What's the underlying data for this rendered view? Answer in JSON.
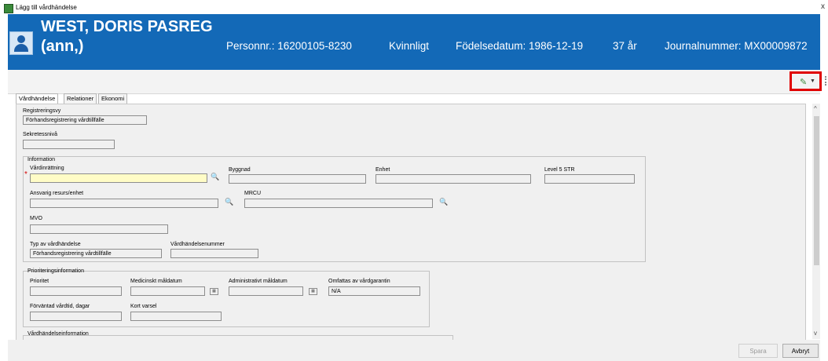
{
  "window": {
    "title": "Lägg till vårdhändelse",
    "close": "x"
  },
  "patient": {
    "name_line1": "WEST, DORIS PASREG",
    "name_line2": "(ann,)",
    "personnr": "Personnr.: 16200105-8230",
    "gender": "Kvinnligt",
    "birthdate": "Födelsedatum: 1986-12-19",
    "age": "37 år",
    "journal": "Journalnummer: MX00009872"
  },
  "toolbar": {
    "action_icon": "pen-icon",
    "dropdown_icon": "chevron-down-icon"
  },
  "tabs": [
    "Vårdhändelse",
    "Relationer",
    "Ekonomi"
  ],
  "form": {
    "registreringsvy_label": "Registreringsvy",
    "registreringsvy_value": "Förhandsregistrering vårdtillfälle",
    "sekretess_label": "Sekretessnivå",
    "sekretess_value": "",
    "information_group": "Information",
    "vardinrattning_label": "Vårdinrättning",
    "byggnad_label": "Byggnad",
    "enhet_label": "Enhet",
    "level5_label": "Level 5 STR",
    "ansvarig_label": "Ansvarig resurs/enhet",
    "mrcu_label": "MRCU",
    "mvo_label": "MVO",
    "typ_label": "Typ av vårdhändelse",
    "typ_value": "Förhandsregistrering vårdtillfälle",
    "vhnummer_label": "Vårdhändelsenummer",
    "prio_group": "Prioriteringsinformation",
    "prioritet_label": "Prioritet",
    "medicinskt_label": "Medicinskt måldatum",
    "admin_label": "Administrativt måldatum",
    "omfattas_label": "Omfattas av vårdgarantin",
    "omfattas_value": "N/A",
    "forvantad_label": "Förväntad vårdtid, dagar",
    "kortvarsel_label": "Kort varsel",
    "vhinfo_group": "Vårdhändelseinformation"
  },
  "buttons": {
    "save": "Spara",
    "cancel": "Avbryt"
  },
  "colors": {
    "header": "#1369b7",
    "highlight_box": "#e00000",
    "required_field": "#fffcc6"
  }
}
